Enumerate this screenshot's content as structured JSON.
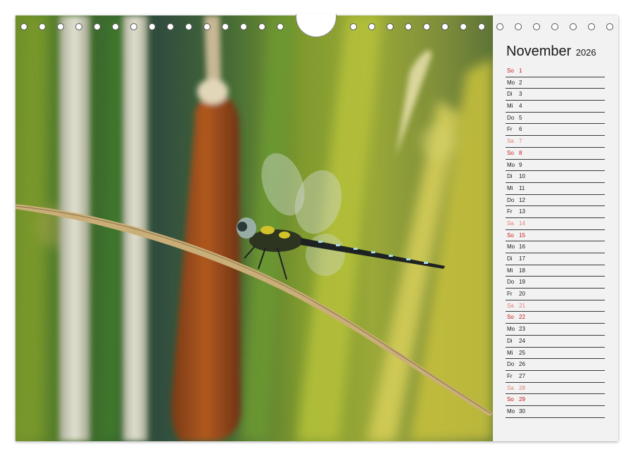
{
  "calendar": {
    "month": "November",
    "year": "2026",
    "days": [
      {
        "wd": "So",
        "d": "1",
        "type": "sun"
      },
      {
        "wd": "Mo",
        "d": "2",
        "type": "weekday"
      },
      {
        "wd": "Di",
        "d": "3",
        "type": "weekday"
      },
      {
        "wd": "Mi",
        "d": "4",
        "type": "weekday"
      },
      {
        "wd": "Do",
        "d": "5",
        "type": "weekday"
      },
      {
        "wd": "Fr",
        "d": "6",
        "type": "weekday"
      },
      {
        "wd": "Sa",
        "d": "7",
        "type": "sat"
      },
      {
        "wd": "So",
        "d": "8",
        "type": "sun"
      },
      {
        "wd": "Mo",
        "d": "9",
        "type": "weekday"
      },
      {
        "wd": "Di",
        "d": "10",
        "type": "weekday"
      },
      {
        "wd": "Mi",
        "d": "11",
        "type": "weekday"
      },
      {
        "wd": "Do",
        "d": "12",
        "type": "weekday"
      },
      {
        "wd": "Fr",
        "d": "13",
        "type": "weekday"
      },
      {
        "wd": "Sa",
        "d": "14",
        "type": "sat"
      },
      {
        "wd": "So",
        "d": "15",
        "type": "sun"
      },
      {
        "wd": "Mo",
        "d": "16",
        "type": "weekday"
      },
      {
        "wd": "Di",
        "d": "17",
        "type": "weekday"
      },
      {
        "wd": "Mi",
        "d": "18",
        "type": "weekday"
      },
      {
        "wd": "Do",
        "d": "19",
        "type": "weekday"
      },
      {
        "wd": "Fr",
        "d": "20",
        "type": "weekday"
      },
      {
        "wd": "Sa",
        "d": "21",
        "type": "sat"
      },
      {
        "wd": "So",
        "d": "22",
        "type": "sun"
      },
      {
        "wd": "Mo",
        "d": "23",
        "type": "weekday"
      },
      {
        "wd": "Di",
        "d": "24",
        "type": "weekday"
      },
      {
        "wd": "Mi",
        "d": "25",
        "type": "weekday"
      },
      {
        "wd": "Do",
        "d": "26",
        "type": "weekday"
      },
      {
        "wd": "Fr",
        "d": "27",
        "type": "weekday"
      },
      {
        "wd": "Sa",
        "d": "28",
        "type": "sat"
      },
      {
        "wd": "So",
        "d": "29",
        "type": "sun"
      },
      {
        "wd": "Mo",
        "d": "30",
        "type": "weekday"
      }
    ]
  },
  "colors": {
    "sunday": "#c81818",
    "saturday": "#e08070",
    "weekday": "#1a1a1a"
  },
  "photo": {
    "subject": "dragonfly-on-reed"
  }
}
